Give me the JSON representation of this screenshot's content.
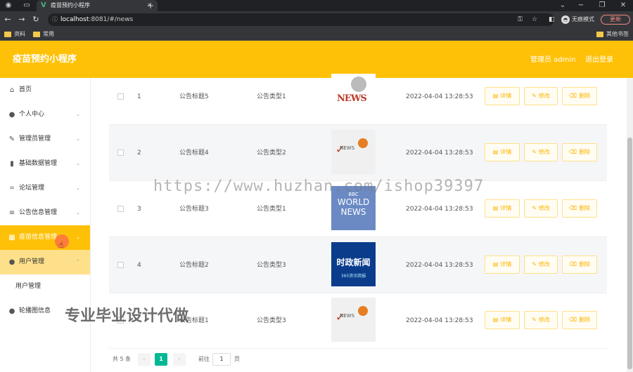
{
  "browser": {
    "tab_title": "疫苗预约小程序",
    "url_host": "localhost",
    "url_rest": ":8081/#/news",
    "incognito_label": "无痕模式",
    "update_label": "更新",
    "bookmarks": [
      "资料",
      "常用"
    ],
    "other_bookmarks": "其他书签"
  },
  "header": {
    "title": "疫苗预约小程序",
    "user": "管理员 admin",
    "logout": "退出登录"
  },
  "sidebar": {
    "items": [
      {
        "label": "首页",
        "icon": "home-icon",
        "glyph": "⌂",
        "chevron": false
      },
      {
        "label": "个人中心",
        "icon": "user-icon",
        "glyph": "●",
        "chevron": true
      },
      {
        "label": "管理员管理",
        "icon": "edit-icon",
        "glyph": "✎",
        "chevron": true
      },
      {
        "label": "基础数据管理",
        "icon": "chart-icon",
        "glyph": "▮",
        "chevron": true
      },
      {
        "label": "论坛管理",
        "icon": "crop-icon",
        "glyph": "⌗",
        "chevron": true
      },
      {
        "label": "公告信息管理",
        "icon": "list-icon",
        "glyph": "≡",
        "chevron": true
      },
      {
        "label": "疫苗信息管理",
        "icon": "grid-icon",
        "glyph": "▦",
        "chevron": true
      },
      {
        "label": "用户管理",
        "icon": "user-icon",
        "glyph": "●",
        "chevron": true
      },
      {
        "label": "轮播图信息",
        "icon": "user-icon",
        "glyph": "●",
        "chevron": false
      }
    ],
    "submenu_user": "用户管理"
  },
  "table": {
    "rows": [
      {
        "index": "1",
        "title": "公告标题5",
        "type": "公告类型1",
        "time": "2022-04-04 13:28:53",
        "img": "news-reporter-image"
      },
      {
        "index": "2",
        "title": "公告标题4",
        "type": "公告类型2",
        "time": "2022-04-04 13:28:53",
        "img": "news-checkmark-image"
      },
      {
        "index": "3",
        "title": "公告标题3",
        "type": "公告类型1",
        "time": "2022-04-04 13:28:53",
        "img": "bbc-world-news-image"
      },
      {
        "index": "4",
        "title": "公告标题2",
        "type": "公告类型3",
        "time": "2022-04-04 13:28:53",
        "img": "chinese-news-image"
      },
      {
        "index": "",
        "title": "公告标题1",
        "type": "公告类型3",
        "time": "2022-04-04 13:28:53",
        "img": "news-checkmark-image"
      }
    ],
    "actions": {
      "detail": "详情",
      "edit": "修改",
      "delete": "删除"
    }
  },
  "images": {
    "news1_text": "NEWS",
    "news2_text": "NEWS",
    "bbc_top": "BBC",
    "bbc_line1": "WORLD",
    "bbc_line2": "NEWS",
    "cn_title": "时政新闻",
    "cn_sub": "365资讯简报"
  },
  "pagination": {
    "total": "共 5 条",
    "current_page": "1",
    "goto_label": "前往",
    "goto_value": "1",
    "page_suffix": "页"
  },
  "watermarks": {
    "url": "https://www.huzhan.com/ishop39397",
    "ad": "专业毕业设计代做"
  }
}
